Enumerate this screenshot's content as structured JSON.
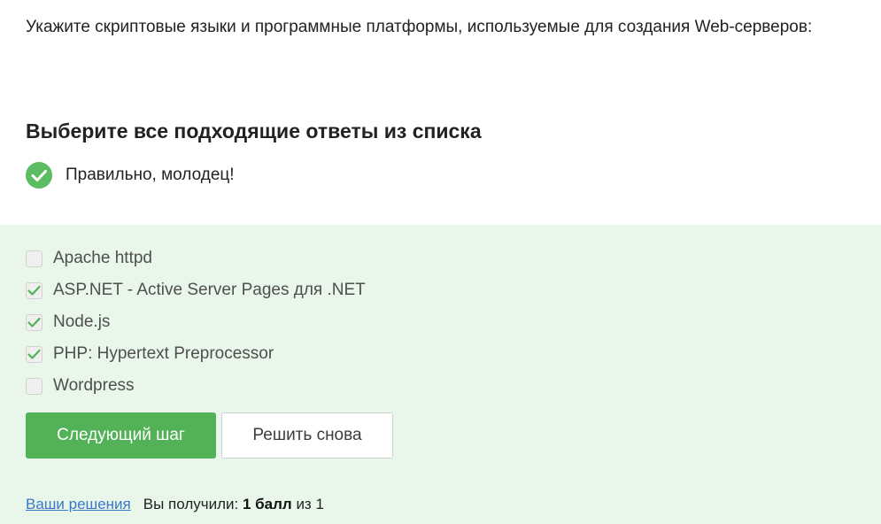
{
  "question": "Укажите скриптовые языки и программные платформы, используемые для создания Web-серверов:",
  "instruction": "Выберите все подходящие ответы из списка",
  "feedback": {
    "icon": "check-circle-icon",
    "text": "Правильно, молодец!",
    "color": "#5cbc61"
  },
  "options": [
    {
      "label": "Apache httpd",
      "checked": false
    },
    {
      "label": "ASP.NET - Active Server Pages для .NET",
      "checked": true
    },
    {
      "label": "Node.js",
      "checked": true
    },
    {
      "label": "PHP: Hypertext Preprocessor",
      "checked": true
    },
    {
      "label": "Wordpress",
      "checked": false
    }
  ],
  "buttons": {
    "next_label": "Следующий шаг",
    "retry_label": "Решить снова"
  },
  "footer": {
    "solutions_link": "Ваши решения",
    "score_prefix": "Вы получили:",
    "score_value": "1 балл",
    "score_suffix": "из 1"
  },
  "colors": {
    "accent_green": "#53b157",
    "panel_background": "#e9f6ea",
    "link_blue": "#3b78c9"
  }
}
